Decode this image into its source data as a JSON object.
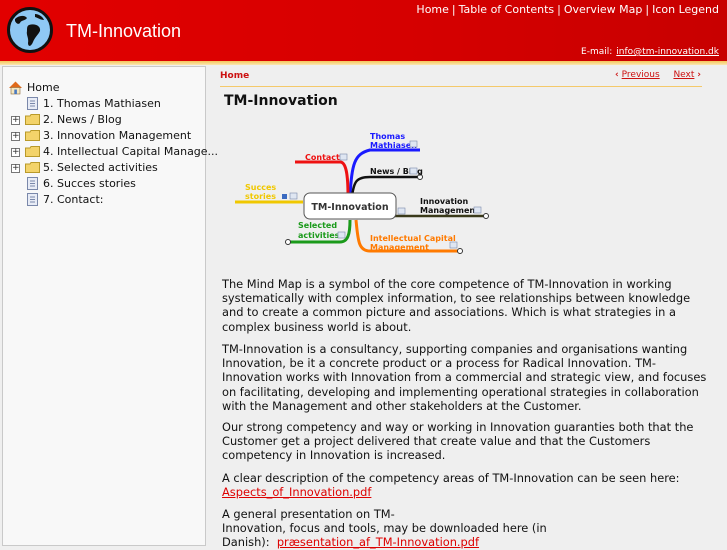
{
  "header": {
    "site_title": "TM-Innovation",
    "logo_icon": "globe-icon",
    "nav": [
      "Home",
      "Table of Contents",
      "Overview Map",
      "Icon Legend"
    ],
    "email_label": "E-mail:",
    "email_value": "info@tm-innovation.dk"
  },
  "sidebar": {
    "home_label": "Home",
    "items": [
      {
        "label": "1. Thomas Mathiasen",
        "type": "page",
        "expandable": false
      },
      {
        "label": "2. News / Blog",
        "type": "folder",
        "expandable": true
      },
      {
        "label": "3. Innovation Management",
        "type": "folder",
        "expandable": true
      },
      {
        "label": "4. Intellectual Capital Manage...",
        "type": "folder",
        "expandable": true
      },
      {
        "label": "5. Selected activities",
        "type": "folder",
        "expandable": true
      },
      {
        "label": "6. Succes stories",
        "type": "page",
        "expandable": false
      },
      {
        "label": "7. Contact:",
        "type": "page",
        "expandable": false
      }
    ]
  },
  "main": {
    "breadcrumb": "Home",
    "previous_label": "Previous",
    "next_label": "Next",
    "title": "TM-Innovation",
    "mindmap": {
      "center": "TM-Innovation",
      "branches": {
        "thomas": "Thomas Mathiasen",
        "thomas_line1": "Thomas",
        "thomas_line2": "Mathiasen",
        "contact": "Contact:",
        "news": "News / Blog",
        "innovation_line1": "Innovation",
        "innovation_line2": "Management",
        "succes_line1": "Succes",
        "succes_line2": "stories",
        "selected_line1": "Selected",
        "selected_line2": "activities",
        "icm_line1": "Intellectual Capital",
        "icm_line2": "Management"
      },
      "colors": {
        "thomas": "#1a1aff",
        "contact": "#ee1111",
        "news": "#111111",
        "innovation": "#3a3a1a",
        "succes": "#f0c800",
        "selected": "#1a9a1a",
        "icm": "#ff7a00"
      }
    },
    "paragraphs": {
      "p1": "The Mind Map is a symbol of the core competence of TM-Innovation in working systematically  with complex  information, to see relationships between knowledge and to create a common  picture and  associations. Which  is what strategies in a complex business world is about.",
      "p2": "TM-Innovation is a consultancy, supporting companies and organisations wanting Innovation, be  it a concrete  product or a process for Radical Innovation. TM-Innovation works with Innovation  from a commercial and  strategic view, and  focuses on facilitating, developing and implementing  operational strategies in collaboration with  the Management and other stakeholders at the  Customer.",
      "p3": "Our strong competency and way or working in Innovation guaranties both that the Customer  get  a project  delivered that create value and that the Customers competency in Innovation is  increased.",
      "p4_text": "A clear description of the competency areas of TM-Innovation can be seen here:",
      "p4_link": "Aspects_of_Innovation.pdf",
      "p5_line1": "A general presentation on TM-",
      "p5_line2": "Innovation, focus and tools, may be downloaded here (in",
      "p5_line3": "Danish):",
      "p5_link": "præsentation_af_TM-Innovation.pdf"
    }
  },
  "colors": {
    "header_red": "#d60000",
    "accent_line": "#f4c96a",
    "link_red": "#cc1111"
  }
}
